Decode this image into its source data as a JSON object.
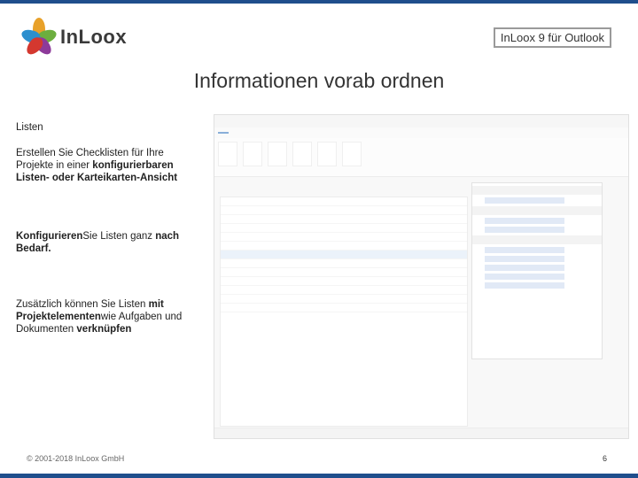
{
  "brand": {
    "logo_text": "InLoox",
    "app_badge": "InLoox 9 für Outlook"
  },
  "slide": {
    "title": "Informationen vorab ordnen"
  },
  "content": {
    "heading": "Listen",
    "p1_a": "Erstellen Sie Checklisten für Ihre Projekte in einer ",
    "p1_b": "konfigurierbaren Listen- oder Karteikarten-Ansicht",
    "p2_a": "Konfigurieren",
    "p2_b": "Sie Listen ganz ",
    "p2_c": "nach Bedarf.",
    "p3_a": "Zusätzlich können Sie Listen ",
    "p3_b": "mit Projektelementen",
    "p3_c": "wie Aufgaben und Dokumenten ",
    "p3_d": "verknüpfen"
  },
  "footer": {
    "copyright": "© 2001-2018 InLoox GmbH",
    "page": "6"
  },
  "colors": {
    "rule": "#1f4e8c",
    "accent": "#2a6ebb"
  }
}
